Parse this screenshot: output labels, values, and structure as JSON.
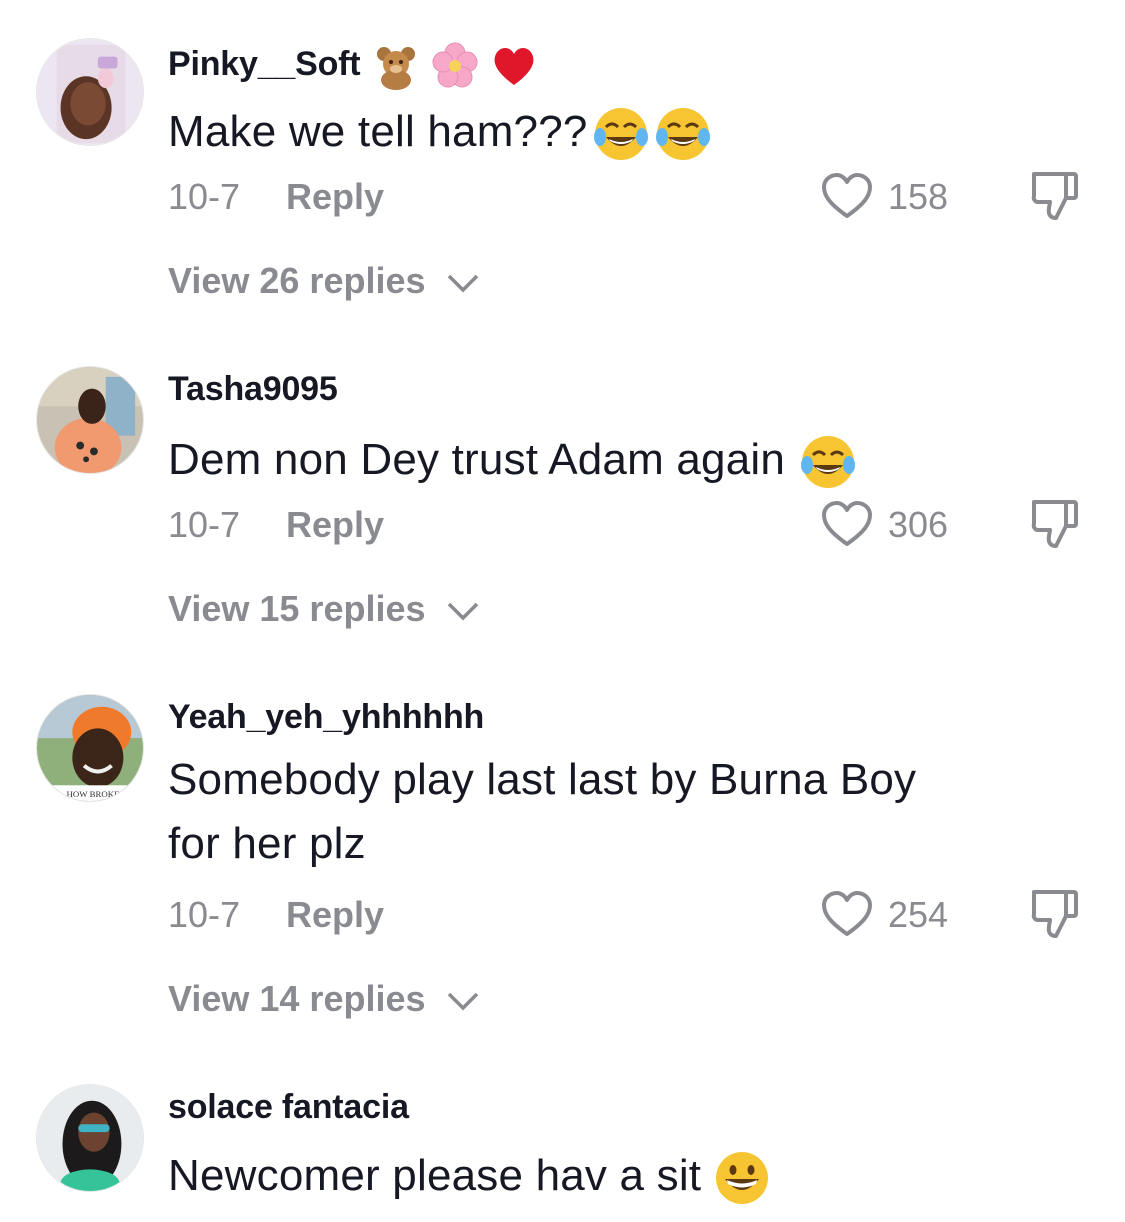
{
  "comments": [
    {
      "username": "Pinky__Soft",
      "username_emojis": [
        "teddy-bear-emoji",
        "cherry-blossom-emoji",
        "red-heart-emoji"
      ],
      "text": "Make we tell ham???",
      "text_emojis": [
        "tears-of-joy-emoji",
        "tears-of-joy-emoji"
      ],
      "date": "10-7",
      "reply_label": "Reply",
      "likes": "158",
      "view_replies": "View 26 replies"
    },
    {
      "username": "Tasha9095",
      "text": "Dem non Dey trust Adam again",
      "text_emojis": [
        "tears-of-joy-emoji"
      ],
      "date": "10-7",
      "reply_label": "Reply",
      "likes": "306",
      "view_replies": "View 15 replies"
    },
    {
      "username": "Yeah_yeh_yhhhhhh",
      "text_line1": "Somebody play last last by Burna Boy",
      "text_line2": "for her plz",
      "avatar_caption": "HOW BROKE GI",
      "date": "10-7",
      "reply_label": "Reply",
      "likes": "254",
      "view_replies": "View 14 replies"
    },
    {
      "username": "solace fantacia",
      "text": "Newcomer please hav a sit",
      "text_emojis": [
        "grinning-emoji"
      ]
    }
  ],
  "colors": {
    "primary_text": "#161823",
    "secondary_text": "#8a8b91",
    "background": "#ffffff"
  },
  "icons": {
    "like": "heart-outline-icon",
    "dislike": "thumbs-down-icon",
    "expand": "chevron-down-icon"
  }
}
